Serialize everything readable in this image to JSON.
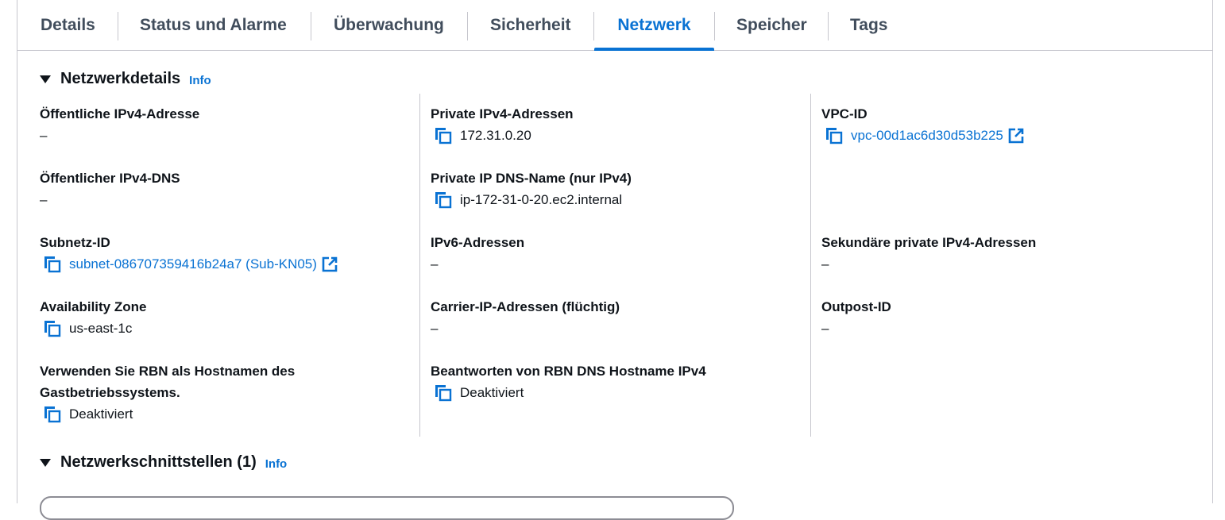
{
  "tabs": [
    {
      "label": "Details"
    },
    {
      "label": "Status und Alarme"
    },
    {
      "label": "Überwachung"
    },
    {
      "label": "Sicherheit"
    },
    {
      "label": "Netzwerk"
    },
    {
      "label": "Speicher"
    },
    {
      "label": "Tags"
    }
  ],
  "active_tab": "Netzwerk",
  "network_details": {
    "title": "Netzwerkdetails",
    "info": "Info",
    "public_ipv4": {
      "label": "Öffentliche IPv4-Adresse",
      "value": "–"
    },
    "public_dns": {
      "label": "Öffentlicher IPv4-DNS",
      "value": "–"
    },
    "subnet": {
      "label": "Subnetz-ID",
      "value": "subnet-086707359416b24a7 (Sub-KN05)"
    },
    "az": {
      "label": "Availability Zone",
      "value": "us-east-1c"
    },
    "rbn_hostname": {
      "label_line1": "Verwenden Sie RBN als Hostnamen des",
      "label_line2": "Gastbetriebssystems.",
      "value": "Deaktiviert"
    },
    "private_ipv4": {
      "label": "Private IPv4-Adressen",
      "value": "172.31.0.20"
    },
    "private_dns": {
      "label": "Private IP DNS-Name (nur IPv4)",
      "value": "ip-172-31-0-20.ec2.internal"
    },
    "ipv6": {
      "label": "IPv6-Adressen",
      "value": "–"
    },
    "carrier_ip": {
      "label": "Carrier-IP-Adressen (flüchtig)",
      "value": "–"
    },
    "rbn_dns": {
      "label": "Beantworten von RBN DNS Hostname IPv4",
      "value": "Deaktiviert"
    },
    "vpc": {
      "label": "VPC-ID",
      "value": "vpc-00d1ac6d30d53b225"
    },
    "secondary_ipv4": {
      "label": "Sekundäre private IPv4-Adressen",
      "value": "–"
    },
    "outpost": {
      "label": "Outpost-ID",
      "value": "–"
    }
  },
  "network_interfaces": {
    "title": "Netzwerkschnittstellen (1)",
    "info": "Info"
  },
  "colors": {
    "accent": "#0972d3",
    "text": "#0f141a",
    "tab_text": "#414d5c",
    "divider": "#c6c6cd"
  }
}
